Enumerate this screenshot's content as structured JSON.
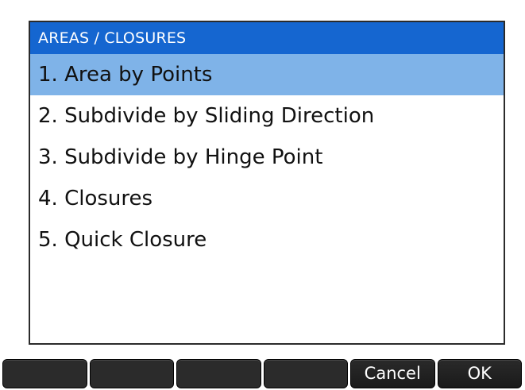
{
  "menu": {
    "title": "AREAS / CLOSURES",
    "selected_index": 0,
    "items": [
      {
        "label": "1. Area by Points"
      },
      {
        "label": "2. Subdivide by Sliding Direction"
      },
      {
        "label": "3. Subdivide by Hinge Point"
      },
      {
        "label": "4. Closures"
      },
      {
        "label": "5. Quick Closure"
      }
    ]
  },
  "softkeys": [
    {
      "label": ""
    },
    {
      "label": ""
    },
    {
      "label": ""
    },
    {
      "label": ""
    },
    {
      "label": "Cancel"
    },
    {
      "label": "OK"
    }
  ],
  "colors": {
    "header_background": "#1566d0",
    "selected_background": "#7fb3e8",
    "softkey_background": "#2b2b2b"
  }
}
